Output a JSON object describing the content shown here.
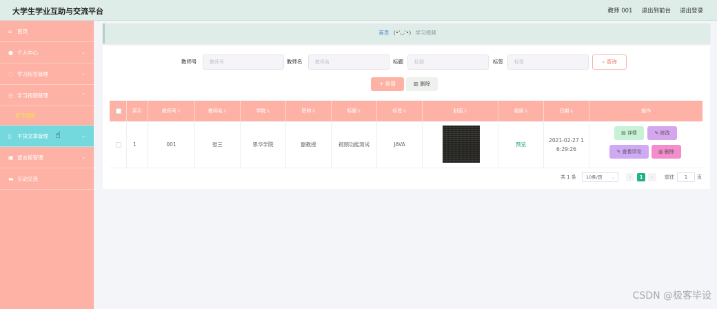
{
  "header": {
    "title": "大学生学业互助与交流平台",
    "user": "教师 001",
    "back": "退出到前台",
    "logout": "退出登录"
  },
  "sidebar": {
    "items": [
      {
        "label": "首页",
        "icon": "home-icon",
        "arrow": ""
      },
      {
        "label": "个人中心",
        "icon": "user-icon",
        "arrow": "⌄"
      },
      {
        "label": "学习标签管理",
        "icon": "tag-icon",
        "arrow": "⌄"
      },
      {
        "label": "学习视频管理",
        "icon": "clock-icon",
        "arrow": "⌃"
      },
      {
        "label": "学习视频",
        "sub": true
      },
      {
        "label": "干货文章管理",
        "icon": "article-icon",
        "arrow": "⌄"
      },
      {
        "label": "留言板管理",
        "icon": "message-icon",
        "arrow": "⌄"
      },
      {
        "label": "互动交流",
        "icon": "chat-icon",
        "arrow": ""
      }
    ]
  },
  "breadcrumb": {
    "home": "首页",
    "emoji": "(•'◡'•)",
    "current": "学习视频"
  },
  "search": {
    "fields": [
      {
        "label": "教师号",
        "placeholder": "教师号"
      },
      {
        "label": "教师名",
        "placeholder": "教师名"
      },
      {
        "label": "标题",
        "placeholder": "标题"
      },
      {
        "label": "标签",
        "placeholder": "标签"
      }
    ],
    "query_button": "查询"
  },
  "toolbar": {
    "add": "新增",
    "delete": "删除"
  },
  "table": {
    "columns": [
      "索引",
      "教师号",
      "教师名",
      "学院",
      "职称",
      "标题",
      "标签",
      "封面",
      "视频",
      "日期",
      "操作"
    ],
    "rows": [
      {
        "index": "1",
        "teacher_no": "001",
        "teacher_name": "张三",
        "college": "思华学院",
        "title_rank": "副教授",
        "title": "视频功能测试",
        "tag": "JAVA",
        "video": "预览",
        "date_line1": "2021-02-27 1",
        "date_line2": "6:29:26"
      }
    ],
    "actions": {
      "detail": "详情",
      "edit": "修改",
      "view_comments": "查看评论",
      "delete": "删除"
    }
  },
  "pagination": {
    "total": "共 1 条",
    "page_size": "10条/页",
    "current_page": "1",
    "goto_label": "前往",
    "goto_value": "1",
    "page_unit": "页"
  },
  "watermark": "CSDN @极客毕设",
  "colors": {
    "sidebar": "#fdb2a5",
    "active_menu": "#73d9dd",
    "header": "#dfede8",
    "table_header": "#fdb2a5",
    "detail_btn": "#c8f2d6",
    "edit_btn": "#d3a6ee",
    "comment_btn": "#d0a9f5",
    "delete_btn": "#f48dcc",
    "page_active": "#1cb386"
  }
}
